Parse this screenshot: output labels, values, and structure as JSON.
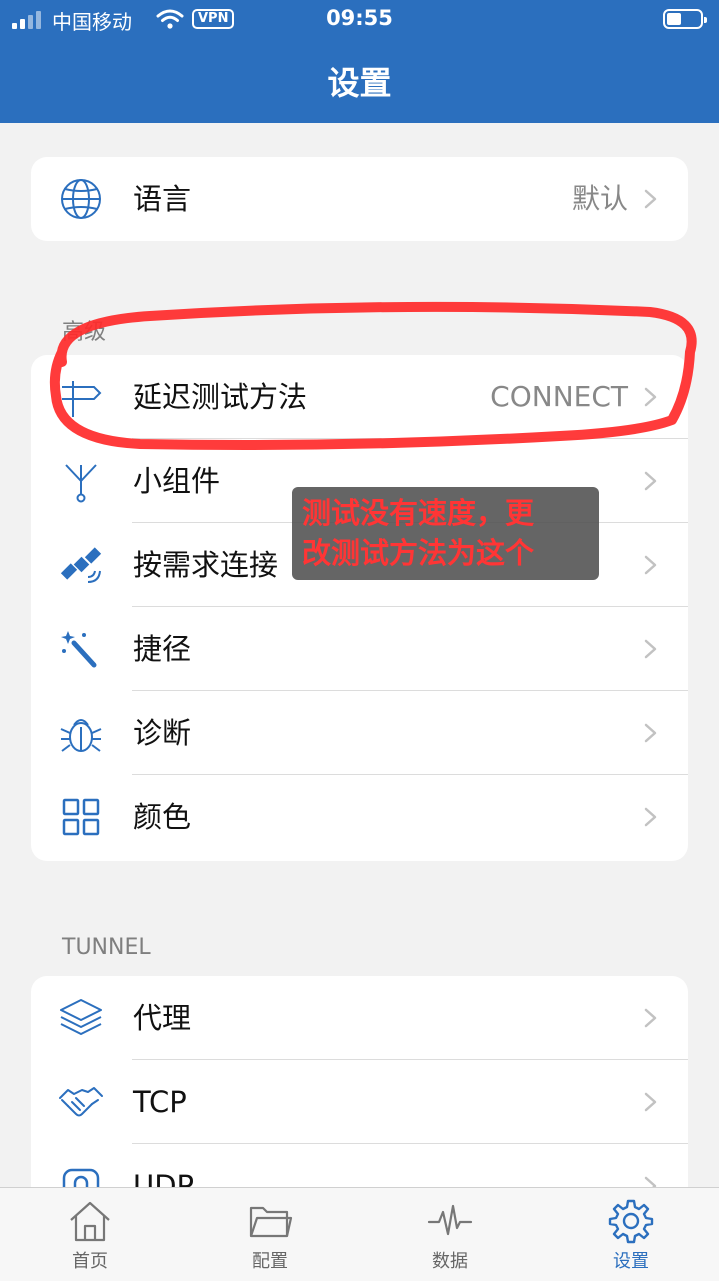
{
  "status_bar": {
    "carrier": "中国移动",
    "vpn": "VPN",
    "time": "09:55"
  },
  "header": {
    "title": "设置"
  },
  "general": {
    "items": [
      {
        "label": "语言",
        "value": "默认",
        "icon": "globe-icon"
      }
    ]
  },
  "advanced": {
    "section_title": "高级",
    "items": [
      {
        "label": "延迟测试方法",
        "value": "CONNECT",
        "icon": "signpost-icon"
      },
      {
        "label": "小组件",
        "value": "",
        "icon": "widget-branch-icon"
      },
      {
        "label": "按需求连接",
        "value": "",
        "icon": "satellite-icon"
      },
      {
        "label": "捷径",
        "value": "",
        "icon": "magic-wand-icon"
      },
      {
        "label": "诊断",
        "value": "",
        "icon": "bug-icon"
      },
      {
        "label": "颜色",
        "value": "",
        "icon": "grid-icon"
      }
    ]
  },
  "tunnel": {
    "section_title": "TUNNEL",
    "items": [
      {
        "label": "代理",
        "value": "",
        "icon": "layers-icon"
      },
      {
        "label": "TCP",
        "value": "",
        "icon": "handshake-icon"
      },
      {
        "label": "UDP",
        "value": "",
        "icon": "udp-icon"
      }
    ]
  },
  "annotation": {
    "line1": "测试没有速度，更",
    "line2": "改测试方法为这个",
    "color": "#ff3535"
  },
  "tabbar": {
    "tabs": [
      {
        "label": "首页",
        "icon": "home-icon",
        "active": false
      },
      {
        "label": "配置",
        "icon": "folder-icon",
        "active": false
      },
      {
        "label": "数据",
        "icon": "pulse-icon",
        "active": false
      },
      {
        "label": "设置",
        "icon": "gear-icon",
        "active": true
      }
    ]
  },
  "colors": {
    "accent": "#2b6fbe",
    "background": "#f2f2f2"
  }
}
